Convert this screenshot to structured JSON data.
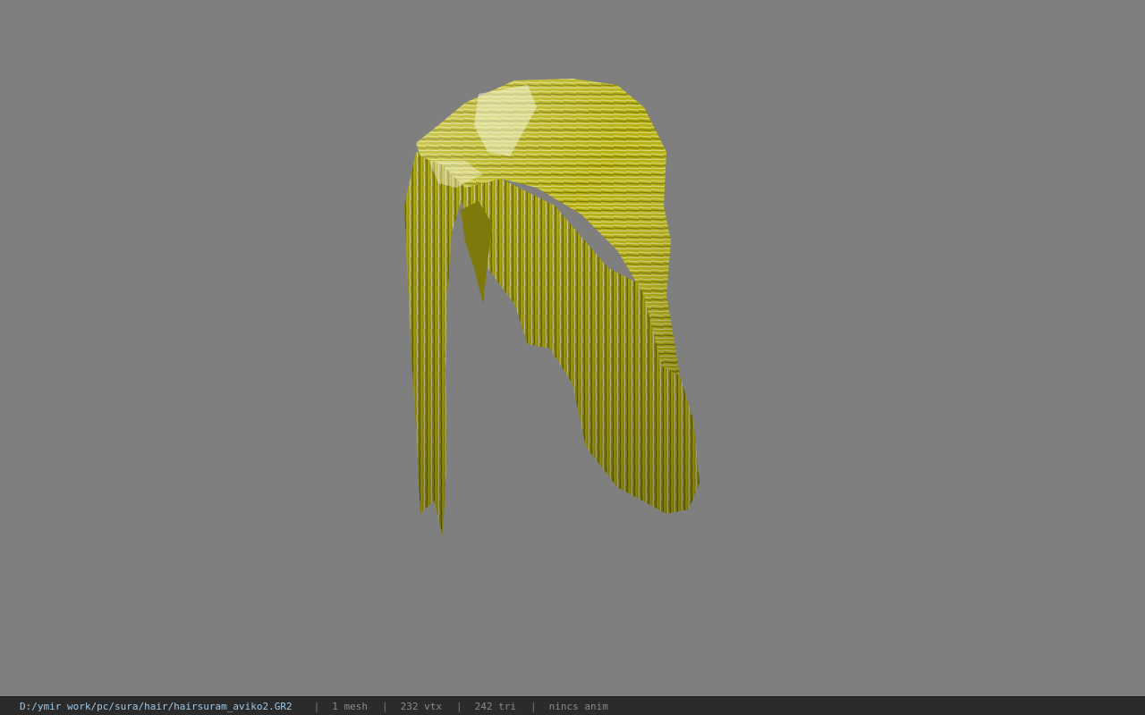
{
  "viewport": {
    "background_color": "#7f7f7f",
    "model": {
      "icon": "hair-mesh-model",
      "base_color": "#b5b00c",
      "highlight_color": "#f2f0c8",
      "shadow_color": "#4a4a05"
    }
  },
  "status_bar": {
    "file_path": "D:/ymir work/pc/sura/hair/hairsuram_aviko2.GR2",
    "separator": "|",
    "mesh_count": "1 mesh",
    "vertex_count": "232 vtx",
    "triangle_count": "242 tri",
    "anim_status": "nincs anim"
  }
}
